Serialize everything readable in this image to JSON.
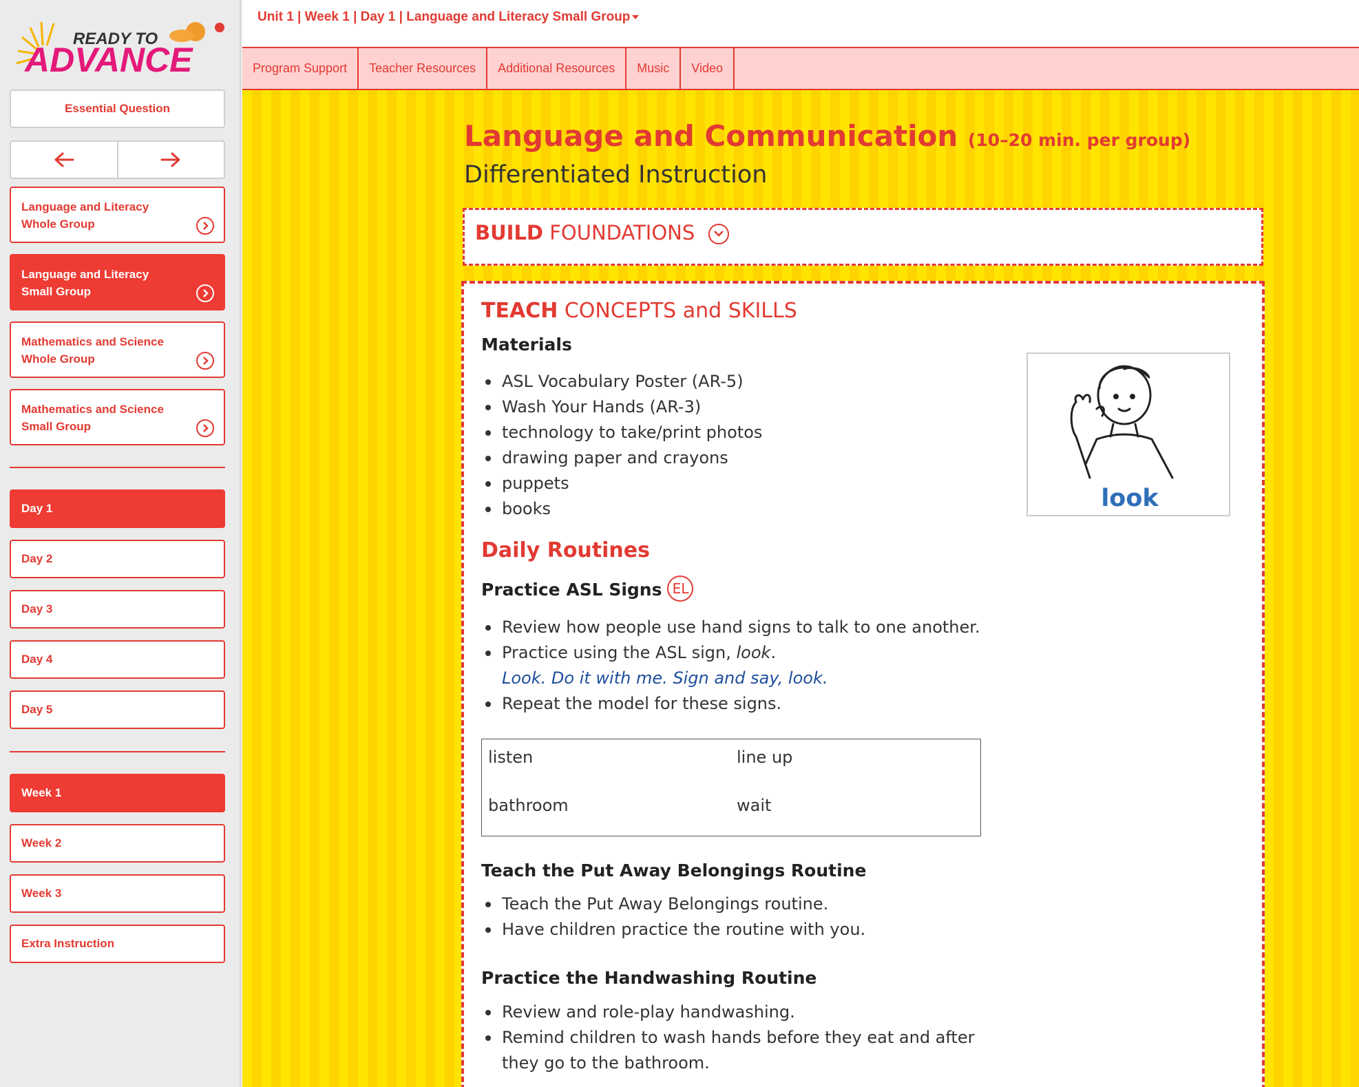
{
  "logo": {
    "line1": "READY TO",
    "line2": "ADVANCE"
  },
  "sidebar": {
    "essential_question": "Essential Question",
    "sections": [
      {
        "label_line1": "Language and Literacy",
        "label_line2": "Whole Group",
        "active": false
      },
      {
        "label_line1": "Language and Literacy",
        "label_line2": "Small Group",
        "active": true
      },
      {
        "label_line1": "Mathematics and Science",
        "label_line2": "Whole Group",
        "active": false
      },
      {
        "label_line1": "Mathematics and Science",
        "label_line2": "Small Group",
        "active": false
      }
    ],
    "days": [
      "Day 1",
      "Day 2",
      "Day 3",
      "Day 4",
      "Day 5"
    ],
    "weeks": [
      "Week 1",
      "Week 2",
      "Week 3",
      "Extra Instruction"
    ]
  },
  "header": {
    "breadcrumb": "Unit 1 | Week 1 | Day 1 | Language and Literacy Small Group"
  },
  "tabs": [
    "Program Support",
    "Teacher Resources",
    "Additional Resources",
    "Music",
    "Video"
  ],
  "content": {
    "title": "Language and Communication",
    "title_note": "(10–20 min. per group)",
    "subtitle": "Differentiated Instruction",
    "build": {
      "bold": "BUILD",
      "rest": "FOUNDATIONS"
    },
    "teach": {
      "bold": "TEACH",
      "rest": "CONCEPTS and SKILLS"
    },
    "materials_heading": "Materials",
    "materials": [
      "ASL Vocabulary Poster (AR-5)",
      "Wash Your Hands (AR-3)",
      "technology to take/print photos",
      "drawing paper and crayons",
      "puppets",
      "books"
    ],
    "image_label": "look",
    "daily_routines": "Daily Routines",
    "asl": {
      "heading": "Practice ASL Signs",
      "badge": "EL",
      "item1": "Review how people use hand signs to talk to one another.",
      "item2_prefix": "Practice using the ASL sign, ",
      "item2_word": "look",
      "item2_suffix": ".",
      "model": "Look. Do it with me. Sign and say, look.",
      "item3": "Repeat the model for these signs.",
      "signs": [
        "listen",
        "line up",
        "bathroom",
        "wait"
      ]
    },
    "belongings": {
      "heading": "Teach the Put Away Belongings Routine",
      "items": [
        "Teach the Put Away Belongings routine.",
        "Have children practice the routine with you."
      ]
    },
    "handwashing": {
      "heading": "Practice the Handwashing Routine",
      "items": [
        "Review and role-play handwashing.",
        "Remind children to wash hands before they eat and after",
        "they go to the bathroom."
      ]
    }
  },
  "colors": {
    "accent": "#e23a32",
    "yellow": "#ffe400",
    "tabs_bg": "#ffd1d1",
    "model_text": "#1f4e9c"
  }
}
